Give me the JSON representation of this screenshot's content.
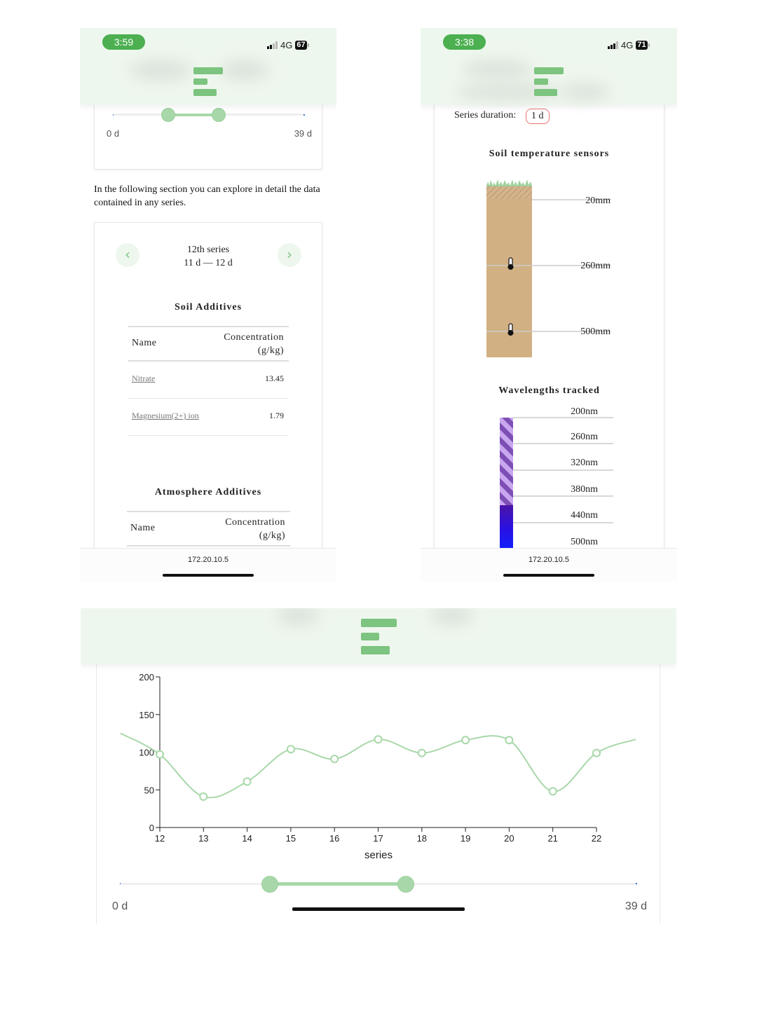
{
  "screen1": {
    "status": {
      "time": "3:59",
      "network": "4G",
      "battery": "67"
    },
    "slider": {
      "min_label": "0 d",
      "max_label": "39 d"
    },
    "intro_text": "In the following section you can explore in detail the data contained in any series.",
    "series_nav": {
      "title": "12th series",
      "range": "11 d — 12 d",
      "prev_icon": "chevron-left-icon",
      "next_icon": "chevron-right-icon"
    },
    "soil_additives": {
      "heading": "Soil Additives",
      "col_name": "Name",
      "col_conc_line1": "Concentration",
      "col_conc_line2": "(g/kg)",
      "rows": [
        {
          "name": "Nitrate",
          "value": "13.45"
        },
        {
          "name": "Magnesium(2+) ion",
          "value": "1.79"
        }
      ]
    },
    "atmosphere_additives": {
      "heading": "Atmosphere Additives",
      "col_name": "Name",
      "col_conc_line1": "Concentration",
      "col_conc_line2": "(g/kg)"
    },
    "footer_url": "172.20.10.5"
  },
  "screen2": {
    "status": {
      "time": "3:38",
      "network": "4G",
      "battery": "71"
    },
    "series_duration_label": "Series duration:",
    "series_duration_value": "1 d",
    "soil_temp_heading": "Soil temperature sensors",
    "depths": [
      "20mm",
      "260mm",
      "500mm"
    ],
    "wavelength_heading": "Wavelengths tracked",
    "wavelengths": [
      "200nm",
      "260nm",
      "320nm",
      "380nm",
      "440nm",
      "500nm"
    ],
    "footer_url": "172.20.10.5"
  },
  "screen3": {
    "slider": {
      "min_label": "0 d",
      "max_label": "39 d"
    },
    "chart_data": {
      "type": "line",
      "xlabel": "series",
      "ylabel": "",
      "ylim": [
        0,
        200
      ],
      "xlim": [
        12,
        22
      ],
      "y_ticks": [
        0,
        50,
        100,
        150,
        200
      ],
      "x_ticks": [
        12,
        13,
        14,
        15,
        16,
        17,
        18,
        19,
        20,
        21,
        22
      ],
      "points": [
        {
          "x": 12,
          "y": 97
        },
        {
          "x": 13,
          "y": 41
        },
        {
          "x": 14,
          "y": 61
        },
        {
          "x": 15,
          "y": 104
        },
        {
          "x": 16,
          "y": 91
        },
        {
          "x": 17,
          "y": 117
        },
        {
          "x": 18,
          "y": 99
        },
        {
          "x": 19,
          "y": 116
        },
        {
          "x": 20,
          "y": 116
        },
        {
          "x": 21,
          "y": 48
        },
        {
          "x": 22,
          "y": 99
        }
      ],
      "line_color": "#a8d8a9"
    }
  }
}
